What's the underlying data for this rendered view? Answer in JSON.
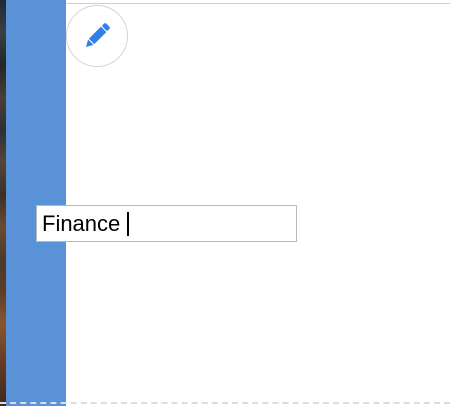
{
  "colors": {
    "sidebar": "#5a92d8",
    "accent_icon": "#2f80e8",
    "field_border": "#b9b9b9"
  },
  "toolbar": {
    "edit_icon": "pencil-icon"
  },
  "editor": {
    "name_value": "Finance"
  }
}
